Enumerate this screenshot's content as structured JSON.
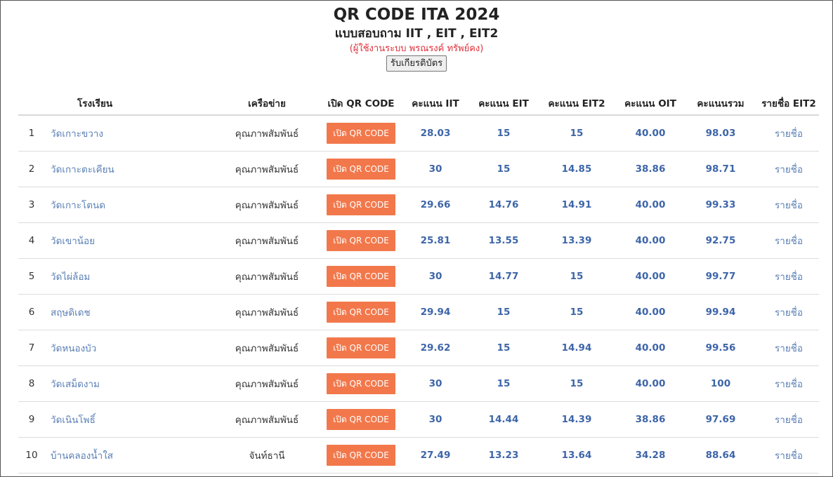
{
  "header": {
    "title": "QR CODE ITA 2024",
    "subtitle": "แบบสอบถาม IIT , EIT , EIT2",
    "user_note": "(ผู้ใช้งานระบบ พรณรงค์ ทรัพย์คง)",
    "certificate_button": "รับเกียรติบัตร"
  },
  "table": {
    "columns": [
      "",
      "โรงเรียน",
      "เครือข่าย",
      "เปิด QR CODE",
      "คะแนน IIT",
      "คะแนน EIT",
      "คะแนน EIT2",
      "คะแนน OIT",
      "คะแนนรวม",
      "รายชื่อ EIT2"
    ],
    "qr_button_label": "เปิด QR CODE",
    "list_link_label": "รายชื่อ",
    "rows": [
      {
        "no": "1",
        "school": "วัดเกาะขวาง",
        "network": "คุณภาพสัมพันธ์",
        "iit": "28.03",
        "eit": "15",
        "eit2": "15",
        "oit": "40.00",
        "total": "98.03"
      },
      {
        "no": "2",
        "school": "วัดเกาะตะเคียน",
        "network": "คุณภาพสัมพันธ์",
        "iit": "30",
        "eit": "15",
        "eit2": "14.85",
        "oit": "38.86",
        "total": "98.71"
      },
      {
        "no": "3",
        "school": "วัดเกาะโตนด",
        "network": "คุณภาพสัมพันธ์",
        "iit": "29.66",
        "eit": "14.76",
        "eit2": "14.91",
        "oit": "40.00",
        "total": "99.33"
      },
      {
        "no": "4",
        "school": "วัดเขาน้อย",
        "network": "คุณภาพสัมพันธ์",
        "iit": "25.81",
        "eit": "13.55",
        "eit2": "13.39",
        "oit": "40.00",
        "total": "92.75"
      },
      {
        "no": "5",
        "school": "วัดไผ่ล้อม",
        "network": "คุณภาพสัมพันธ์",
        "iit": "30",
        "eit": "14.77",
        "eit2": "15",
        "oit": "40.00",
        "total": "99.77"
      },
      {
        "no": "6",
        "school": "สฤษดิเดช",
        "network": "คุณภาพสัมพันธ์",
        "iit": "29.94",
        "eit": "15",
        "eit2": "15",
        "oit": "40.00",
        "total": "99.94"
      },
      {
        "no": "7",
        "school": "วัดหนองบัว",
        "network": "คุณภาพสัมพันธ์",
        "iit": "29.62",
        "eit": "15",
        "eit2": "14.94",
        "oit": "40.00",
        "total": "99.56"
      },
      {
        "no": "8",
        "school": "วัดเสม็ดงาม",
        "network": "คุณภาพสัมพันธ์",
        "iit": "30",
        "eit": "15",
        "eit2": "15",
        "oit": "40.00",
        "total": "100"
      },
      {
        "no": "9",
        "school": "วัดเนินโพธิ์",
        "network": "คุณภาพสัมพันธ์",
        "iit": "30",
        "eit": "14.44",
        "eit2": "14.39",
        "oit": "38.86",
        "total": "97.69"
      },
      {
        "no": "10",
        "school": "บ้านคลองน้ำใส",
        "network": "จันท์ธานี",
        "iit": "27.49",
        "eit": "13.23",
        "eit2": "13.64",
        "oit": "34.28",
        "total": "88.64"
      }
    ]
  },
  "colors": {
    "qr_button": "#f2784b",
    "score_text": "#3d65a8",
    "link_text": "#5a7fb5",
    "user_note": "#e0303a"
  }
}
